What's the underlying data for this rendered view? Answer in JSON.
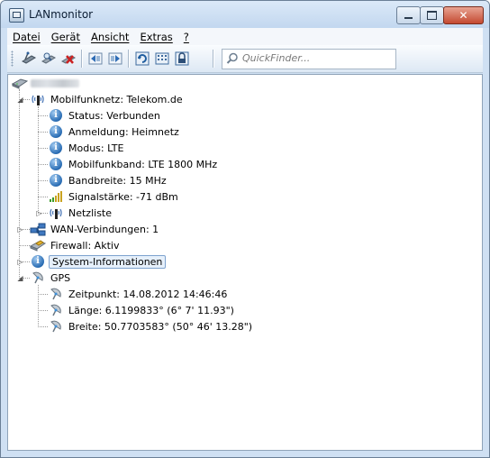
{
  "window": {
    "title": "LANmonitor"
  },
  "menu": [
    "Datei",
    "Gerät",
    "Ansicht",
    "Extras",
    "?"
  ],
  "quickfinder": {
    "placeholder": "QuickFinder..."
  },
  "tree": {
    "mobile": {
      "label": "Mobilfunknetz: Telekom.de",
      "children": [
        "Status: Verbunden",
        "Anmeldung: Heimnetz",
        "Modus: LTE",
        "Mobilfunkband: LTE 1800 MHz",
        "Bandbreite: 15 MHz",
        "Signalstärke: -71 dBm",
        "Netzliste"
      ]
    },
    "wan": "WAN-Verbindungen: 1",
    "firewall": "Firewall: Aktiv",
    "sysinfo": "System-Informationen",
    "gps": {
      "label": "GPS",
      "children": [
        "Zeitpunkt: 14.08.2012 14:46:46",
        "Länge: 6.1199833° (6° 7' 11.93\")",
        "Breite: 50.7703583° (50° 46' 13.28\")"
      ]
    }
  }
}
